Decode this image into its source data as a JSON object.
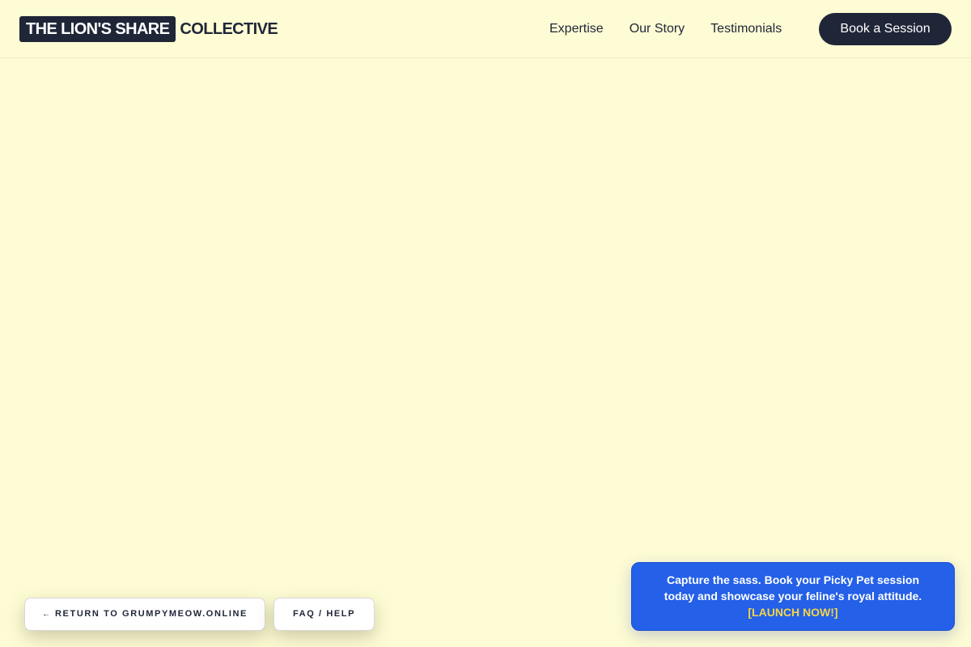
{
  "header": {
    "logo_highlight": "THE LION'S SHARE",
    "logo_rest": "COLLECTIVE",
    "nav": [
      {
        "label": "Expertise"
      },
      {
        "label": "Our Story"
      },
      {
        "label": "Testimonials"
      }
    ],
    "cta_label": "Book a Session"
  },
  "footer_buttons": {
    "return_arrow": "←",
    "return_label": "RETURN TO GRUMPYMEOW.ONLINE",
    "faq_label": "FAQ / HELP"
  },
  "promo": {
    "line1": "Capture the sass. Book your Picky Pet session",
    "line2": "today and showcase your feline's royal attitude.",
    "link_label": "[LAUNCH NOW!]"
  },
  "colors": {
    "background": "#fefcd4",
    "dark": "#1f2638",
    "promo_blue": "#2460e8",
    "promo_link": "#f5d547"
  }
}
